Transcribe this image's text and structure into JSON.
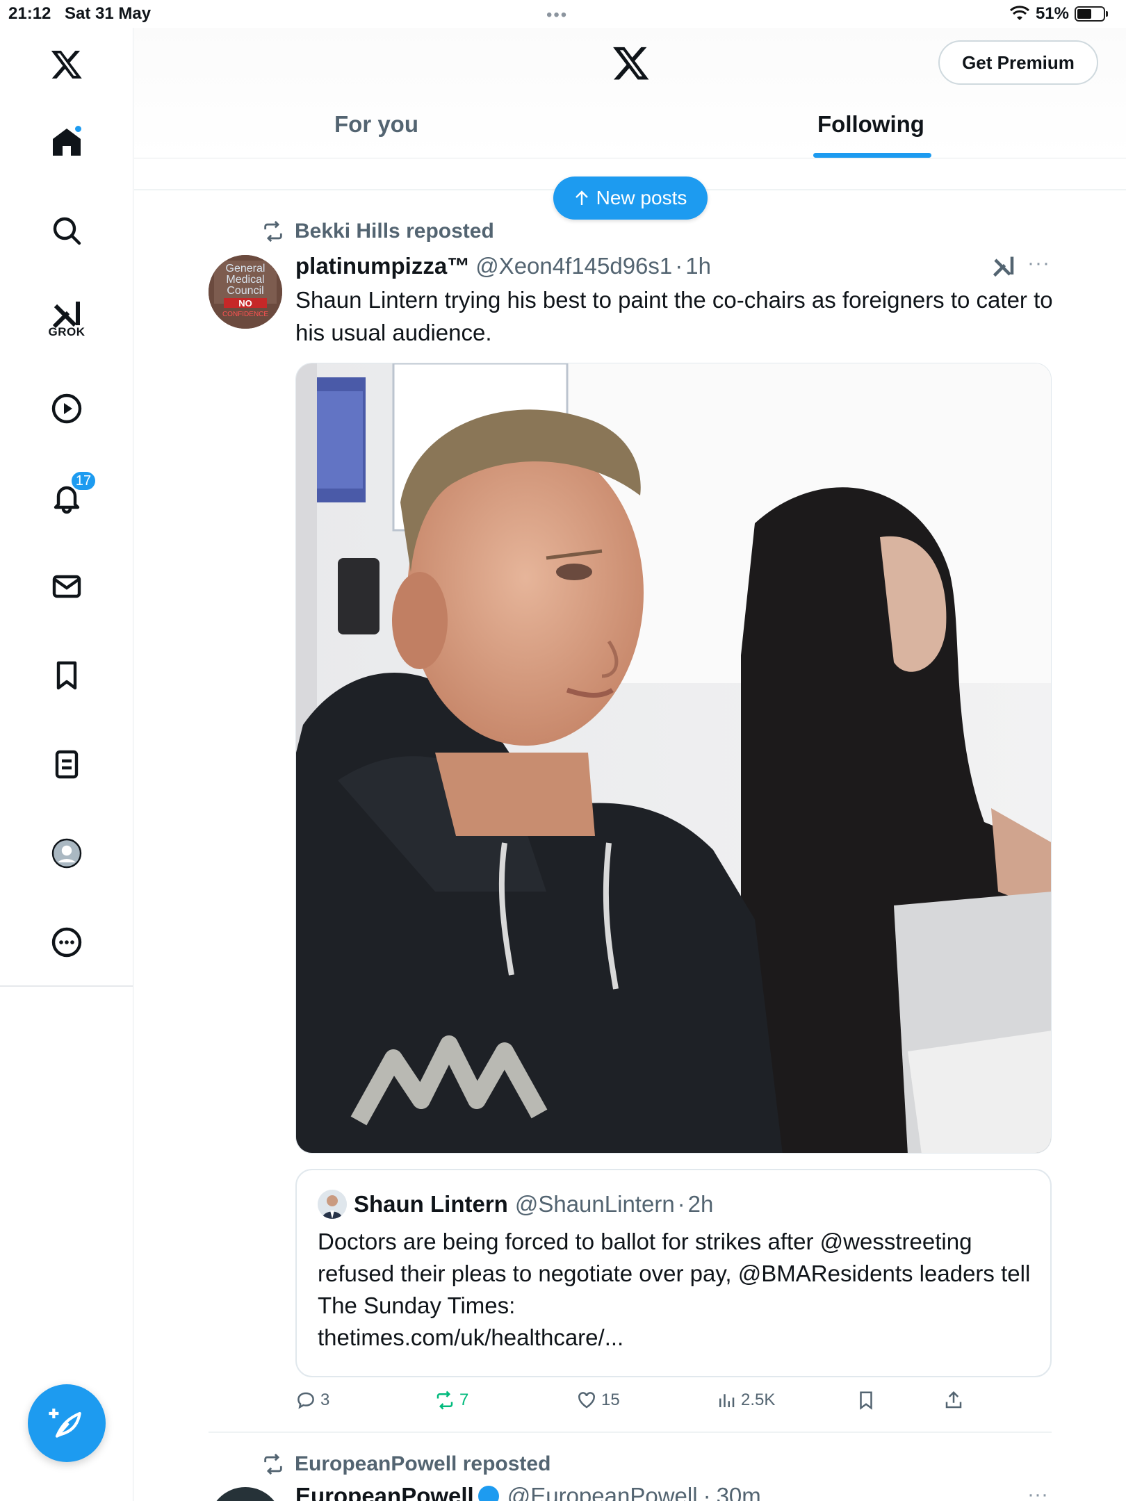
{
  "status_bar": {
    "time": "21:12",
    "date": "Sat 31 May",
    "battery": "51%",
    "battery_level": 0.51
  },
  "sidebar": {
    "grok_label": "GROK",
    "notifications_count": "17",
    "items": [
      "home-icon",
      "search-icon",
      "grok-icon",
      "video-icon",
      "bell-icon",
      "mail-icon",
      "bookmark-icon",
      "lists-icon",
      "profile-icon",
      "more-icon"
    ]
  },
  "header": {
    "premium_label": "Get Premium",
    "tabs": [
      {
        "label": "For you"
      },
      {
        "label": "Following"
      }
    ]
  },
  "new_posts_label": "New posts",
  "post": {
    "repost_by": "Bekki Hills reposted",
    "author_name": "platinumpizza™",
    "author_handle": "@Xeon4f145d96s1",
    "time": "1h",
    "text": "Shaun Lintern trying his best to paint the co-chairs as foreigners to cater to his usual audience.",
    "avatar_text": [
      "General",
      "Medical",
      "Council",
      "NO",
      "CONFIDENCE"
    ],
    "quote": {
      "name": "Shaun Lintern",
      "handle": "@ShaunLintern",
      "time": "2h",
      "text": "Doctors are being forced to ballot for strikes after @wesstreeting refused their pleas to negotiate over pay, @BMAResidents leaders tell The Sunday Times:",
      "link": "thetimes.com/uk/healthcare/..."
    },
    "stats": {
      "replies": "3",
      "reposts": "7",
      "likes": "15",
      "views": "2.5K"
    }
  },
  "next_post": {
    "repost_by": "EuropeanPowell reposted",
    "author_name": "EuropeanPowell",
    "author_handle": "@EuropeanPowell",
    "time": "30m"
  }
}
